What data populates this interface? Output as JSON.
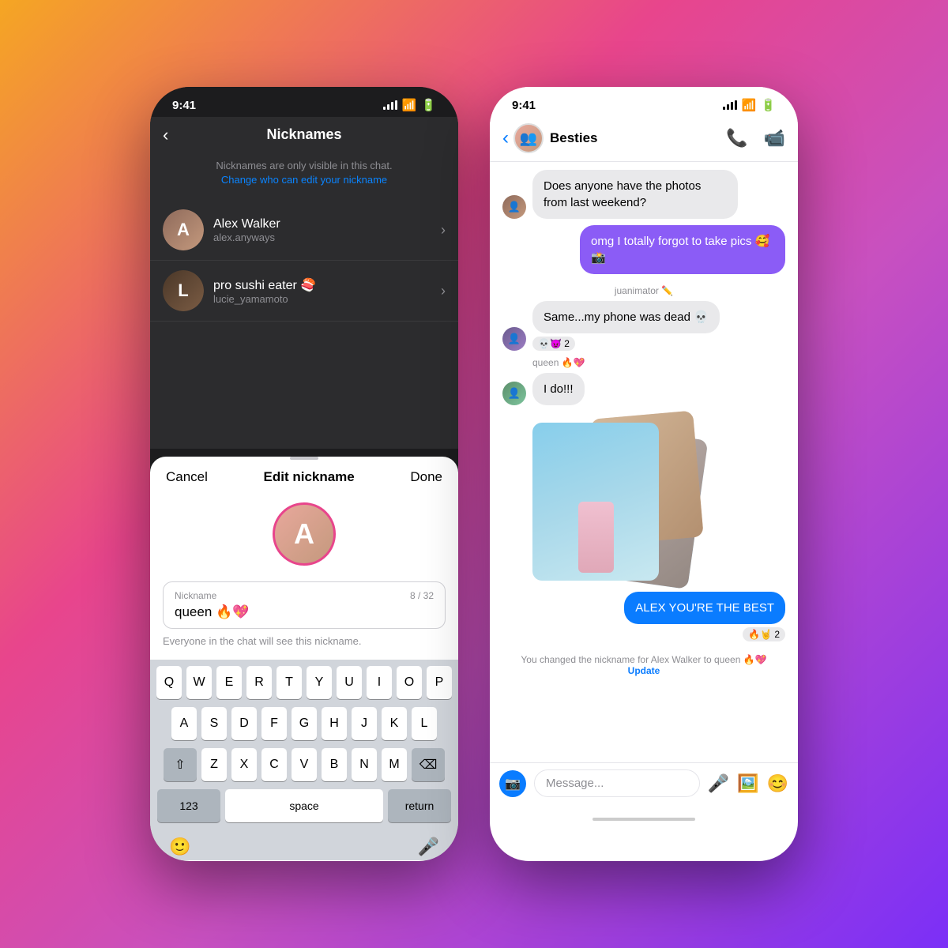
{
  "background": "linear-gradient(135deg, #f5a623 0%, #e8458c 35%, #c850c0 60%, #7b2ff7 100%)",
  "leftPhone": {
    "statusBar": {
      "time": "9:41",
      "battery": "🔋"
    },
    "nicknames": {
      "title": "Nicknames",
      "subtitle": "Nicknames are only visible in this chat.",
      "subtitleLink": "Change who can edit your nickname",
      "contacts": [
        {
          "name": "Alex Walker",
          "username": "alex.anyways"
        },
        {
          "name": "pro sushi eater 🍣",
          "username": "lucie_yamamoto"
        }
      ]
    },
    "sheet": {
      "cancel": "Cancel",
      "title": "Edit nickname",
      "done": "Done",
      "label": "Nickname",
      "value": "queen 🔥💖",
      "charCount": "8 / 32",
      "hint": "Everyone in the chat will see this nickname."
    },
    "keyboard": {
      "rows": [
        [
          "Q",
          "W",
          "E",
          "R",
          "T",
          "Y",
          "U",
          "I",
          "O",
          "P"
        ],
        [
          "A",
          "S",
          "D",
          "F",
          "G",
          "H",
          "J",
          "K",
          "L"
        ],
        [
          "⇧",
          "Z",
          "X",
          "C",
          "V",
          "B",
          "N",
          "M",
          "⌫"
        ],
        [
          "123",
          "space",
          "return"
        ]
      ]
    }
  },
  "rightPhone": {
    "statusBar": {
      "time": "9:41"
    },
    "chat": {
      "title": "Besties",
      "messages": [
        {
          "id": 1,
          "sender": "other",
          "text": "Does anyone have the photos from last weekend?",
          "type": "gray"
        },
        {
          "id": 2,
          "sender": "me",
          "text": "omg I totally forgot to take pics 🥰📸",
          "type": "purple"
        },
        {
          "id": 3,
          "sender": "system",
          "text": "juanimator ✏️"
        },
        {
          "id": 4,
          "sender": "other2",
          "text": "Same...my phone was dead 💀\n💀😈 2",
          "type": "gray"
        },
        {
          "id": 5,
          "sender": "system2",
          "text": "queen 🔥💖"
        },
        {
          "id": 6,
          "sender": "other3",
          "text": "I do!!!",
          "type": "gray"
        },
        {
          "id": 7,
          "sender": "collage"
        },
        {
          "id": 8,
          "sender": "me",
          "text": "ALEX YOU'RE THE BEST\n🔥🤘 2",
          "type": "blue"
        },
        {
          "id": 9,
          "sender": "system_notice",
          "text": "You changed the nickname for Alex Walker to queen 🔥💖",
          "link": "Update"
        }
      ],
      "inputPlaceholder": "Message..."
    }
  }
}
